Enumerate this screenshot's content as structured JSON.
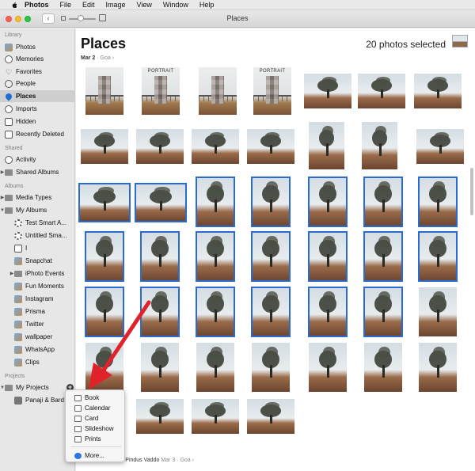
{
  "menubar": {
    "app": "Photos",
    "items": [
      "File",
      "Edit",
      "Image",
      "View",
      "Window",
      "Help"
    ]
  },
  "window": {
    "title": "Places",
    "back_label": "‹"
  },
  "sidebar": {
    "sections": [
      {
        "label": "Library",
        "items": [
          {
            "label": "Photos",
            "icon": "photos-icon"
          },
          {
            "label": "Memories",
            "icon": "memories-icon"
          },
          {
            "label": "Favorites",
            "icon": "heart-icon"
          },
          {
            "label": "People",
            "icon": "person-icon"
          },
          {
            "label": "Places",
            "icon": "pin-icon",
            "selected": true
          },
          {
            "label": "Imports",
            "icon": "clock-icon"
          },
          {
            "label": "Hidden",
            "icon": "hidden-icon"
          },
          {
            "label": "Recently Deleted",
            "icon": "trash-icon"
          }
        ]
      },
      {
        "label": "Shared",
        "items": [
          {
            "label": "Activity",
            "icon": "cloud-icon"
          },
          {
            "label": "Shared Albums",
            "icon": "cloud-folder-icon"
          }
        ]
      },
      {
        "label": "Albums",
        "items": [
          {
            "label": "Media Types",
            "icon": "folder-icon"
          },
          {
            "label": "My Albums",
            "icon": "folder-icon"
          },
          {
            "label": "Test Smart A...",
            "icon": "smart-album-icon"
          },
          {
            "label": "Untitled Sma...",
            "icon": "smart-album-icon"
          },
          {
            "label": "I",
            "icon": "album-icon"
          },
          {
            "label": "Snapchat",
            "icon": "album-icon"
          },
          {
            "label": "iPhoto Events",
            "icon": "folder-icon"
          },
          {
            "label": "Fun Moments",
            "icon": "album-icon"
          },
          {
            "label": "Instagram",
            "icon": "album-icon"
          },
          {
            "label": "Prisma",
            "icon": "album-icon"
          },
          {
            "label": "Twitter",
            "icon": "album-icon"
          },
          {
            "label": "wallpaper",
            "icon": "album-icon"
          },
          {
            "label": "WhatsApp",
            "icon": "album-icon"
          },
          {
            "label": "Clips",
            "icon": "album-icon"
          }
        ]
      },
      {
        "label": "Projects",
        "items": [
          {
            "label": "My Projects",
            "icon": "folder-icon"
          },
          {
            "label": "Panaji & Bard",
            "icon": "book-icon"
          }
        ]
      }
    ]
  },
  "main": {
    "title": "Places",
    "selection_count": "20 photos selected",
    "date": "Mar 2",
    "location": "Goa",
    "portrait_badge": "PORTRAIT",
    "footer_text": "...Vaddo, Marra & Pindus Vaddo",
    "footer_date": "Mar 3",
    "footer_location": "Goa"
  },
  "popup_menu": {
    "items": [
      {
        "label": "Book",
        "icon": "book-icon"
      },
      {
        "label": "Calendar",
        "icon": "calendar-icon"
      },
      {
        "label": "Card",
        "icon": "card-icon"
      },
      {
        "label": "Slideshow",
        "icon": "slideshow-icon"
      },
      {
        "label": "Prints",
        "icon": "prints-icon"
      }
    ],
    "more_label": "More..."
  },
  "colors": {
    "selection_blue": "#2a6bd1",
    "arrow_red": "#e0222a"
  }
}
